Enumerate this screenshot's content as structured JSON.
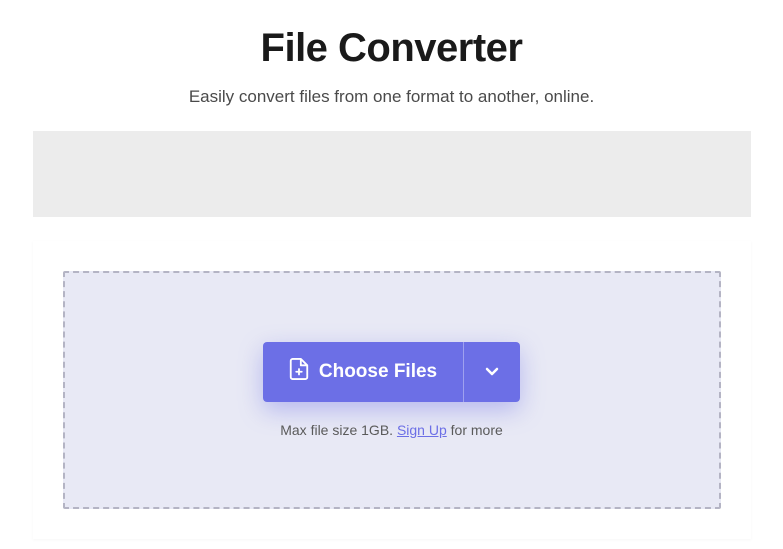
{
  "header": {
    "title": "File Converter",
    "subtitle": "Easily convert files from one format to another, online."
  },
  "dropzone": {
    "choose_files_label": "Choose Files",
    "hint_prefix": "Max file size 1GB. ",
    "signup_link_label": "Sign Up",
    "hint_suffix": " for more"
  },
  "colors": {
    "accent": "#6c6fe6"
  }
}
